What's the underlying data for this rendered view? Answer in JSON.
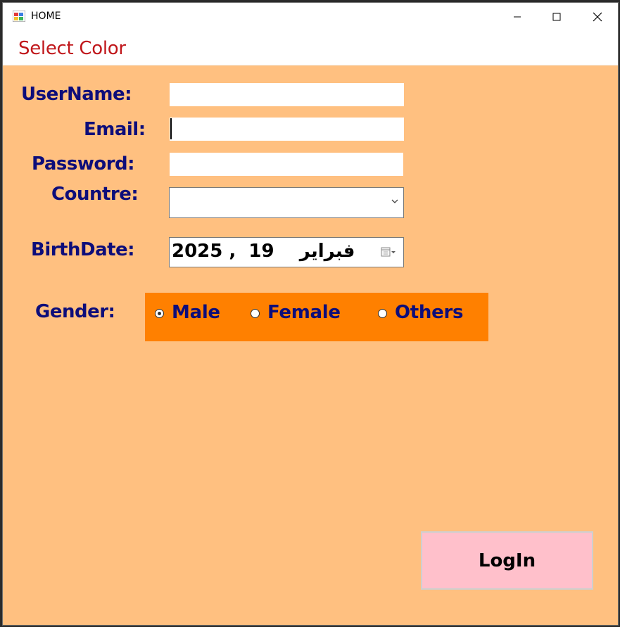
{
  "window": {
    "title": "HOME",
    "icon": "winforms-app-icon",
    "controls": [
      "minimize-icon",
      "maximize-icon",
      "close-icon"
    ]
  },
  "menu": {
    "items": [
      {
        "label": "Select Color"
      }
    ]
  },
  "form": {
    "username_label": "UserName:",
    "username_value": "",
    "email_label": "Email:",
    "email_value": "",
    "password_label": "Password:",
    "password_value": "",
    "country_label": "Countre:",
    "country_value": "",
    "birthdate_label": "BirthDate:",
    "birthdate_value": "2025 ,  فبراير    19",
    "gender_label": "Gender:",
    "gender_options": [
      {
        "label": "Male",
        "checked": true
      },
      {
        "label": "Female",
        "checked": false
      },
      {
        "label": "Others",
        "checked": false
      }
    ],
    "login_label": "LogIn"
  },
  "colors": {
    "form_background": "#ffc080",
    "label_text": "#0d0d7a",
    "gender_panel": "#ff8000",
    "menu_text": "#c0171b",
    "login_button": "#ffc0cb"
  }
}
